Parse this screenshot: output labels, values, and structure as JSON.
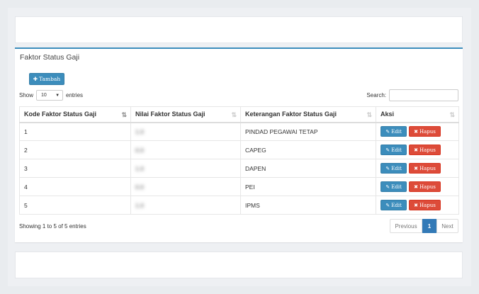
{
  "box": {
    "title": "Faktor Status Gaji"
  },
  "toolbar": {
    "add_label": "Tambah",
    "add_icon": "plus-icon"
  },
  "length": {
    "show_label": "Show",
    "value": "10",
    "entries_label": "entries"
  },
  "search": {
    "label": "Search:",
    "value": ""
  },
  "table": {
    "headers": [
      "Kode Faktor Status Gaji",
      "Nilai Faktor Status Gaji",
      "Keterangan Faktor Status Gaji",
      "Aksi"
    ],
    "rows": [
      {
        "kode": "1",
        "nilai": "1.0",
        "keterangan": "PINDAD PEGAWAI TETAP"
      },
      {
        "kode": "2",
        "nilai": "0.0",
        "keterangan": "CAPEG"
      },
      {
        "kode": "3",
        "nilai": "1.0",
        "keterangan": "DAPEN"
      },
      {
        "kode": "4",
        "nilai": "0.0",
        "keterangan": "PEI"
      },
      {
        "kode": "5",
        "nilai": "1.0",
        "keterangan": "IPMS"
      }
    ],
    "edit_label": "Edit",
    "delete_label": "Hapus"
  },
  "info": "Showing 1 to 5 of 5 entries",
  "pagination": {
    "previous": "Previous",
    "current": "1",
    "next": "Next"
  },
  "colors": {
    "primary": "#3c8dbc",
    "danger": "#dd4b39",
    "page_active": "#337ab7"
  }
}
